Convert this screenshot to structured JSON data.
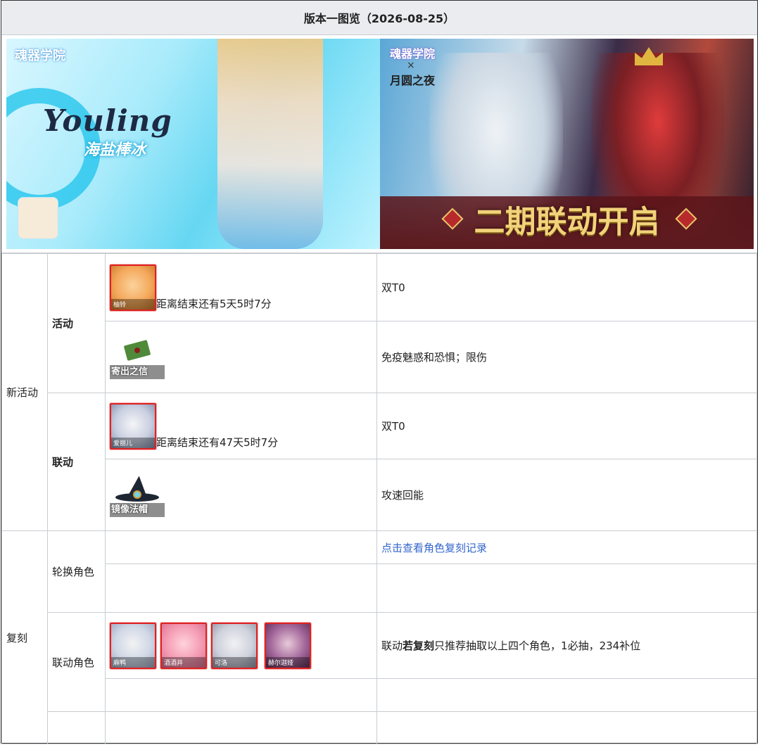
{
  "header": {
    "title": "版本一图览（2026-08-25）"
  },
  "banners": {
    "left": {
      "title": "Youling",
      "subtitle": "海盐棒冰",
      "logo": "魂器学院"
    },
    "right": {
      "logo_top": "魂器学院",
      "cross": "×",
      "logo_bottom": "月圆之夜",
      "headline": "二期联动开启"
    }
  },
  "sections": {
    "new_activity": {
      "label": "新活动",
      "activity": {
        "label": "活动",
        "character": {
          "name": "柚铃",
          "countdown": "距离结束还有5天5时7分",
          "note": "双T0"
        },
        "item": {
          "name": "寄出之信",
          "note": "免疫魅惑和恐惧；限伤"
        }
      },
      "collab": {
        "label": "联动",
        "character": {
          "name": "爱丽儿",
          "countdown": "距离结束还有47天5时7分",
          "note": "双T0"
        },
        "item": {
          "name": "镜像法帽",
          "note": "攻速回能"
        }
      }
    },
    "rerun": {
      "label": "复刻",
      "rotation": {
        "label": "轮换角色",
        "link": "点击查看角色复刻记录"
      },
      "collab_chars": {
        "label": "联动角色",
        "characters": [
          "麻鸭",
          "酒酒井",
          "可洛",
          "赫尔迦娅"
        ],
        "note_prefix": "联动",
        "note_bold": "若复刻",
        "note_suffix": "只推荐抽取以上四个角色，1必抽，234补位"
      }
    }
  }
}
